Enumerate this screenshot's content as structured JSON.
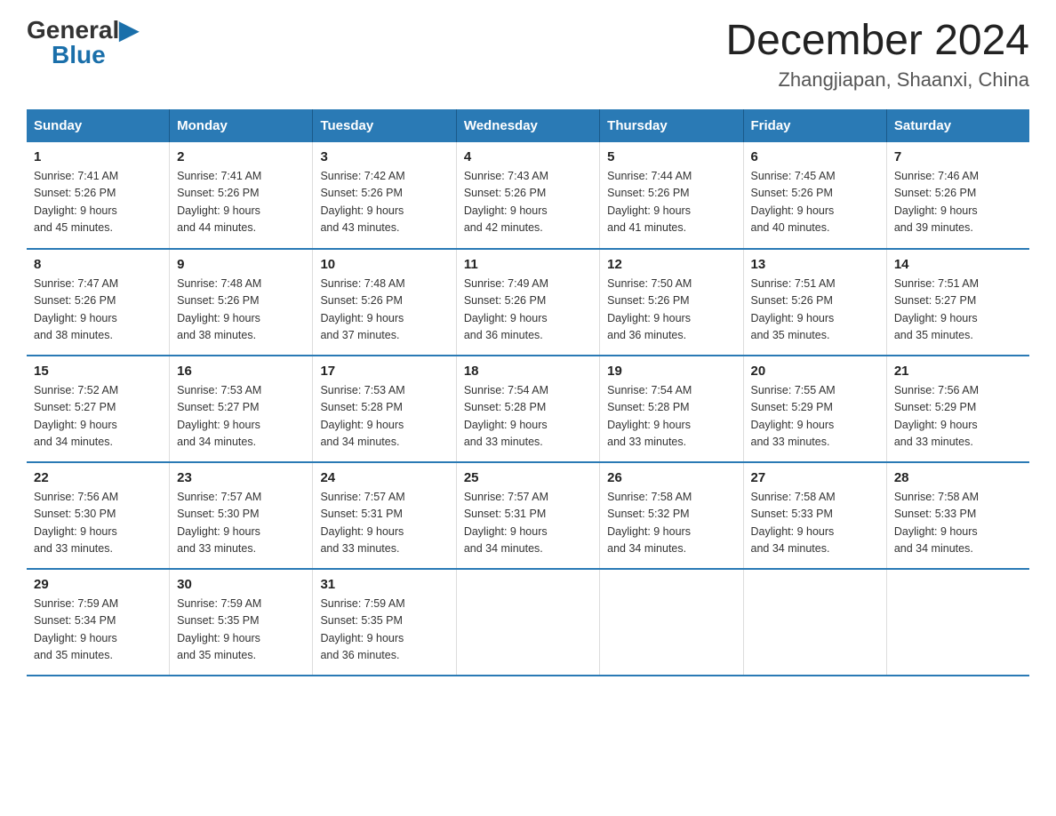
{
  "header": {
    "logo_general": "General",
    "logo_blue": "Blue",
    "title": "December 2024",
    "subtitle": "Zhangjiapan, Shaanxi, China"
  },
  "columns": [
    "Sunday",
    "Monday",
    "Tuesday",
    "Wednesday",
    "Thursday",
    "Friday",
    "Saturday"
  ],
  "weeks": [
    [
      {
        "day": "1",
        "info": "Sunrise: 7:41 AM\nSunset: 5:26 PM\nDaylight: 9 hours\nand 45 minutes."
      },
      {
        "day": "2",
        "info": "Sunrise: 7:41 AM\nSunset: 5:26 PM\nDaylight: 9 hours\nand 44 minutes."
      },
      {
        "day": "3",
        "info": "Sunrise: 7:42 AM\nSunset: 5:26 PM\nDaylight: 9 hours\nand 43 minutes."
      },
      {
        "day": "4",
        "info": "Sunrise: 7:43 AM\nSunset: 5:26 PM\nDaylight: 9 hours\nand 42 minutes."
      },
      {
        "day": "5",
        "info": "Sunrise: 7:44 AM\nSunset: 5:26 PM\nDaylight: 9 hours\nand 41 minutes."
      },
      {
        "day": "6",
        "info": "Sunrise: 7:45 AM\nSunset: 5:26 PM\nDaylight: 9 hours\nand 40 minutes."
      },
      {
        "day": "7",
        "info": "Sunrise: 7:46 AM\nSunset: 5:26 PM\nDaylight: 9 hours\nand 39 minutes."
      }
    ],
    [
      {
        "day": "8",
        "info": "Sunrise: 7:47 AM\nSunset: 5:26 PM\nDaylight: 9 hours\nand 38 minutes."
      },
      {
        "day": "9",
        "info": "Sunrise: 7:48 AM\nSunset: 5:26 PM\nDaylight: 9 hours\nand 38 minutes."
      },
      {
        "day": "10",
        "info": "Sunrise: 7:48 AM\nSunset: 5:26 PM\nDaylight: 9 hours\nand 37 minutes."
      },
      {
        "day": "11",
        "info": "Sunrise: 7:49 AM\nSunset: 5:26 PM\nDaylight: 9 hours\nand 36 minutes."
      },
      {
        "day": "12",
        "info": "Sunrise: 7:50 AM\nSunset: 5:26 PM\nDaylight: 9 hours\nand 36 minutes."
      },
      {
        "day": "13",
        "info": "Sunrise: 7:51 AM\nSunset: 5:26 PM\nDaylight: 9 hours\nand 35 minutes."
      },
      {
        "day": "14",
        "info": "Sunrise: 7:51 AM\nSunset: 5:27 PM\nDaylight: 9 hours\nand 35 minutes."
      }
    ],
    [
      {
        "day": "15",
        "info": "Sunrise: 7:52 AM\nSunset: 5:27 PM\nDaylight: 9 hours\nand 34 minutes."
      },
      {
        "day": "16",
        "info": "Sunrise: 7:53 AM\nSunset: 5:27 PM\nDaylight: 9 hours\nand 34 minutes."
      },
      {
        "day": "17",
        "info": "Sunrise: 7:53 AM\nSunset: 5:28 PM\nDaylight: 9 hours\nand 34 minutes."
      },
      {
        "day": "18",
        "info": "Sunrise: 7:54 AM\nSunset: 5:28 PM\nDaylight: 9 hours\nand 33 minutes."
      },
      {
        "day": "19",
        "info": "Sunrise: 7:54 AM\nSunset: 5:28 PM\nDaylight: 9 hours\nand 33 minutes."
      },
      {
        "day": "20",
        "info": "Sunrise: 7:55 AM\nSunset: 5:29 PM\nDaylight: 9 hours\nand 33 minutes."
      },
      {
        "day": "21",
        "info": "Sunrise: 7:56 AM\nSunset: 5:29 PM\nDaylight: 9 hours\nand 33 minutes."
      }
    ],
    [
      {
        "day": "22",
        "info": "Sunrise: 7:56 AM\nSunset: 5:30 PM\nDaylight: 9 hours\nand 33 minutes."
      },
      {
        "day": "23",
        "info": "Sunrise: 7:57 AM\nSunset: 5:30 PM\nDaylight: 9 hours\nand 33 minutes."
      },
      {
        "day": "24",
        "info": "Sunrise: 7:57 AM\nSunset: 5:31 PM\nDaylight: 9 hours\nand 33 minutes."
      },
      {
        "day": "25",
        "info": "Sunrise: 7:57 AM\nSunset: 5:31 PM\nDaylight: 9 hours\nand 34 minutes."
      },
      {
        "day": "26",
        "info": "Sunrise: 7:58 AM\nSunset: 5:32 PM\nDaylight: 9 hours\nand 34 minutes."
      },
      {
        "day": "27",
        "info": "Sunrise: 7:58 AM\nSunset: 5:33 PM\nDaylight: 9 hours\nand 34 minutes."
      },
      {
        "day": "28",
        "info": "Sunrise: 7:58 AM\nSunset: 5:33 PM\nDaylight: 9 hours\nand 34 minutes."
      }
    ],
    [
      {
        "day": "29",
        "info": "Sunrise: 7:59 AM\nSunset: 5:34 PM\nDaylight: 9 hours\nand 35 minutes."
      },
      {
        "day": "30",
        "info": "Sunrise: 7:59 AM\nSunset: 5:35 PM\nDaylight: 9 hours\nand 35 minutes."
      },
      {
        "day": "31",
        "info": "Sunrise: 7:59 AM\nSunset: 5:35 PM\nDaylight: 9 hours\nand 36 minutes."
      },
      {
        "day": "",
        "info": ""
      },
      {
        "day": "",
        "info": ""
      },
      {
        "day": "",
        "info": ""
      },
      {
        "day": "",
        "info": ""
      }
    ]
  ]
}
